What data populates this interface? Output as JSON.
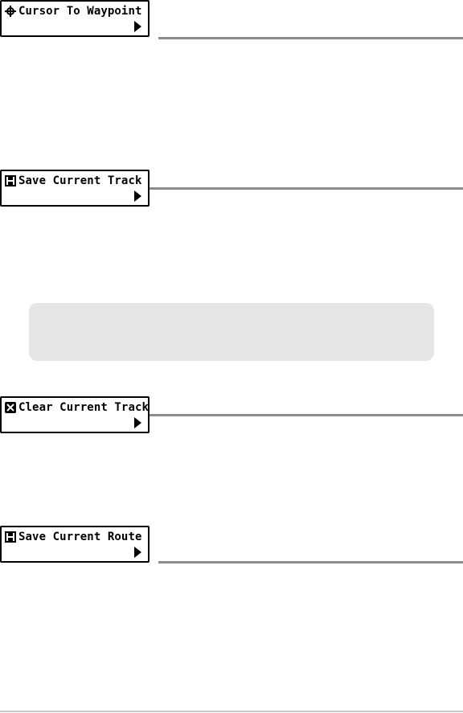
{
  "menus": [
    {
      "label": "Cursor To Waypoint",
      "icon": "crosshair-icon"
    },
    {
      "label": "Save Current Track",
      "icon": "save-icon"
    },
    {
      "label": "Clear Current Track",
      "icon": "clear-icon"
    },
    {
      "label": "Save Current Route",
      "icon": "save-icon"
    }
  ],
  "colors": {
    "rule": "#8c8c8c",
    "note_background": "#e6e6e6"
  }
}
